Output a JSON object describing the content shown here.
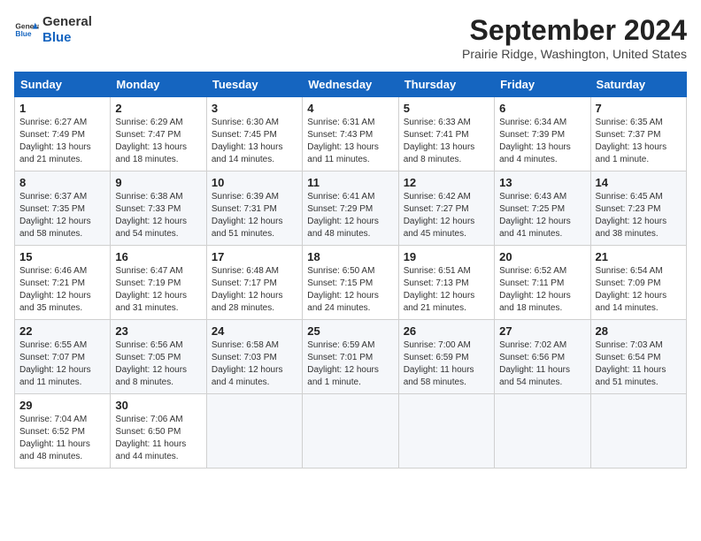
{
  "header": {
    "logo_line1": "General",
    "logo_line2": "Blue",
    "month": "September 2024",
    "location": "Prairie Ridge, Washington, United States"
  },
  "days_of_week": [
    "Sunday",
    "Monday",
    "Tuesday",
    "Wednesday",
    "Thursday",
    "Friday",
    "Saturday"
  ],
  "weeks": [
    [
      {
        "day": "1",
        "text": "Sunrise: 6:27 AM\nSunset: 7:49 PM\nDaylight: 13 hours\nand 21 minutes."
      },
      {
        "day": "2",
        "text": "Sunrise: 6:29 AM\nSunset: 7:47 PM\nDaylight: 13 hours\nand 18 minutes."
      },
      {
        "day": "3",
        "text": "Sunrise: 6:30 AM\nSunset: 7:45 PM\nDaylight: 13 hours\nand 14 minutes."
      },
      {
        "day": "4",
        "text": "Sunrise: 6:31 AM\nSunset: 7:43 PM\nDaylight: 13 hours\nand 11 minutes."
      },
      {
        "day": "5",
        "text": "Sunrise: 6:33 AM\nSunset: 7:41 PM\nDaylight: 13 hours\nand 8 minutes."
      },
      {
        "day": "6",
        "text": "Sunrise: 6:34 AM\nSunset: 7:39 PM\nDaylight: 13 hours\nand 4 minutes."
      },
      {
        "day": "7",
        "text": "Sunrise: 6:35 AM\nSunset: 7:37 PM\nDaylight: 13 hours\nand 1 minute."
      }
    ],
    [
      {
        "day": "8",
        "text": "Sunrise: 6:37 AM\nSunset: 7:35 PM\nDaylight: 12 hours\nand 58 minutes."
      },
      {
        "day": "9",
        "text": "Sunrise: 6:38 AM\nSunset: 7:33 PM\nDaylight: 12 hours\nand 54 minutes."
      },
      {
        "day": "10",
        "text": "Sunrise: 6:39 AM\nSunset: 7:31 PM\nDaylight: 12 hours\nand 51 minutes."
      },
      {
        "day": "11",
        "text": "Sunrise: 6:41 AM\nSunset: 7:29 PM\nDaylight: 12 hours\nand 48 minutes."
      },
      {
        "day": "12",
        "text": "Sunrise: 6:42 AM\nSunset: 7:27 PM\nDaylight: 12 hours\nand 45 minutes."
      },
      {
        "day": "13",
        "text": "Sunrise: 6:43 AM\nSunset: 7:25 PM\nDaylight: 12 hours\nand 41 minutes."
      },
      {
        "day": "14",
        "text": "Sunrise: 6:45 AM\nSunset: 7:23 PM\nDaylight: 12 hours\nand 38 minutes."
      }
    ],
    [
      {
        "day": "15",
        "text": "Sunrise: 6:46 AM\nSunset: 7:21 PM\nDaylight: 12 hours\nand 35 minutes."
      },
      {
        "day": "16",
        "text": "Sunrise: 6:47 AM\nSunset: 7:19 PM\nDaylight: 12 hours\nand 31 minutes."
      },
      {
        "day": "17",
        "text": "Sunrise: 6:48 AM\nSunset: 7:17 PM\nDaylight: 12 hours\nand 28 minutes."
      },
      {
        "day": "18",
        "text": "Sunrise: 6:50 AM\nSunset: 7:15 PM\nDaylight: 12 hours\nand 24 minutes."
      },
      {
        "day": "19",
        "text": "Sunrise: 6:51 AM\nSunset: 7:13 PM\nDaylight: 12 hours\nand 21 minutes."
      },
      {
        "day": "20",
        "text": "Sunrise: 6:52 AM\nSunset: 7:11 PM\nDaylight: 12 hours\nand 18 minutes."
      },
      {
        "day": "21",
        "text": "Sunrise: 6:54 AM\nSunset: 7:09 PM\nDaylight: 12 hours\nand 14 minutes."
      }
    ],
    [
      {
        "day": "22",
        "text": "Sunrise: 6:55 AM\nSunset: 7:07 PM\nDaylight: 12 hours\nand 11 minutes."
      },
      {
        "day": "23",
        "text": "Sunrise: 6:56 AM\nSunset: 7:05 PM\nDaylight: 12 hours\nand 8 minutes."
      },
      {
        "day": "24",
        "text": "Sunrise: 6:58 AM\nSunset: 7:03 PM\nDaylight: 12 hours\nand 4 minutes."
      },
      {
        "day": "25",
        "text": "Sunrise: 6:59 AM\nSunset: 7:01 PM\nDaylight: 12 hours\nand 1 minute."
      },
      {
        "day": "26",
        "text": "Sunrise: 7:00 AM\nSunset: 6:59 PM\nDaylight: 11 hours\nand 58 minutes."
      },
      {
        "day": "27",
        "text": "Sunrise: 7:02 AM\nSunset: 6:56 PM\nDaylight: 11 hours\nand 54 minutes."
      },
      {
        "day": "28",
        "text": "Sunrise: 7:03 AM\nSunset: 6:54 PM\nDaylight: 11 hours\nand 51 minutes."
      }
    ],
    [
      {
        "day": "29",
        "text": "Sunrise: 7:04 AM\nSunset: 6:52 PM\nDaylight: 11 hours\nand 48 minutes."
      },
      {
        "day": "30",
        "text": "Sunrise: 7:06 AM\nSunset: 6:50 PM\nDaylight: 11 hours\nand 44 minutes."
      },
      {
        "day": "",
        "text": ""
      },
      {
        "day": "",
        "text": ""
      },
      {
        "day": "",
        "text": ""
      },
      {
        "day": "",
        "text": ""
      },
      {
        "day": "",
        "text": ""
      }
    ]
  ]
}
